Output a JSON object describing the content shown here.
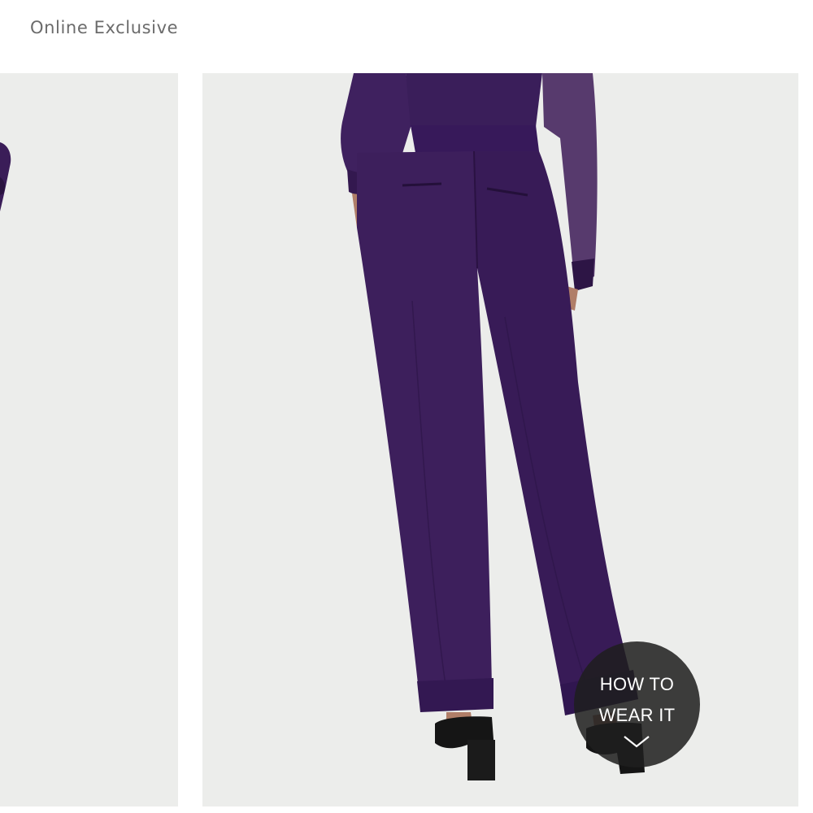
{
  "product": {
    "badge": "Online Exclusive"
  },
  "how_to_wear": {
    "line1": "HOW TO",
    "line2": "WEAR IT"
  },
  "gallery": {
    "background_color": "#ecedeb",
    "garment_color": "#3d1f5c"
  }
}
